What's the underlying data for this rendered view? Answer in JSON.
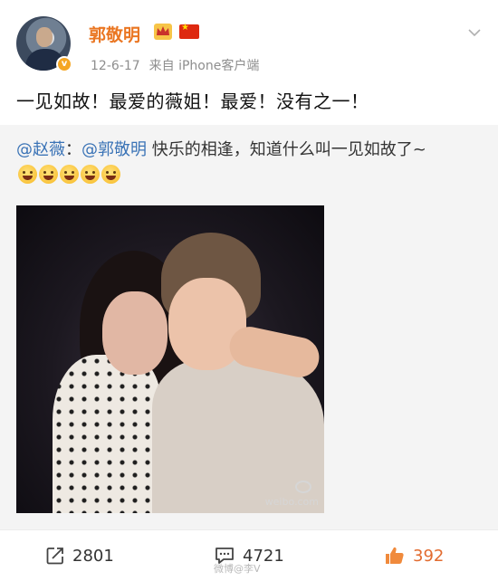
{
  "user": {
    "name": "郭敬明",
    "verified_mark": "v"
  },
  "meta": {
    "date": "12-6-17",
    "source": "来自 iPhone客户端"
  },
  "post": {
    "text": "一见如故！最爱的薇姐！最爱！没有之一！"
  },
  "repost": {
    "mention_1": "@赵薇",
    "separator": "：",
    "mention_2": "@郭敬明",
    "text": " 快乐的相逢，知道什么叫一见如故了~",
    "emoji_count": 5
  },
  "photo": {
    "watermark": "weibo.com"
  },
  "actions": {
    "repost_count": "2801",
    "comment_count": "4721",
    "like_count": "392"
  },
  "footer": {
    "watermark": "微博@李V"
  },
  "colors": {
    "username": "#ea7622",
    "mention": "#3a73b6",
    "like": "#e26b2f"
  }
}
